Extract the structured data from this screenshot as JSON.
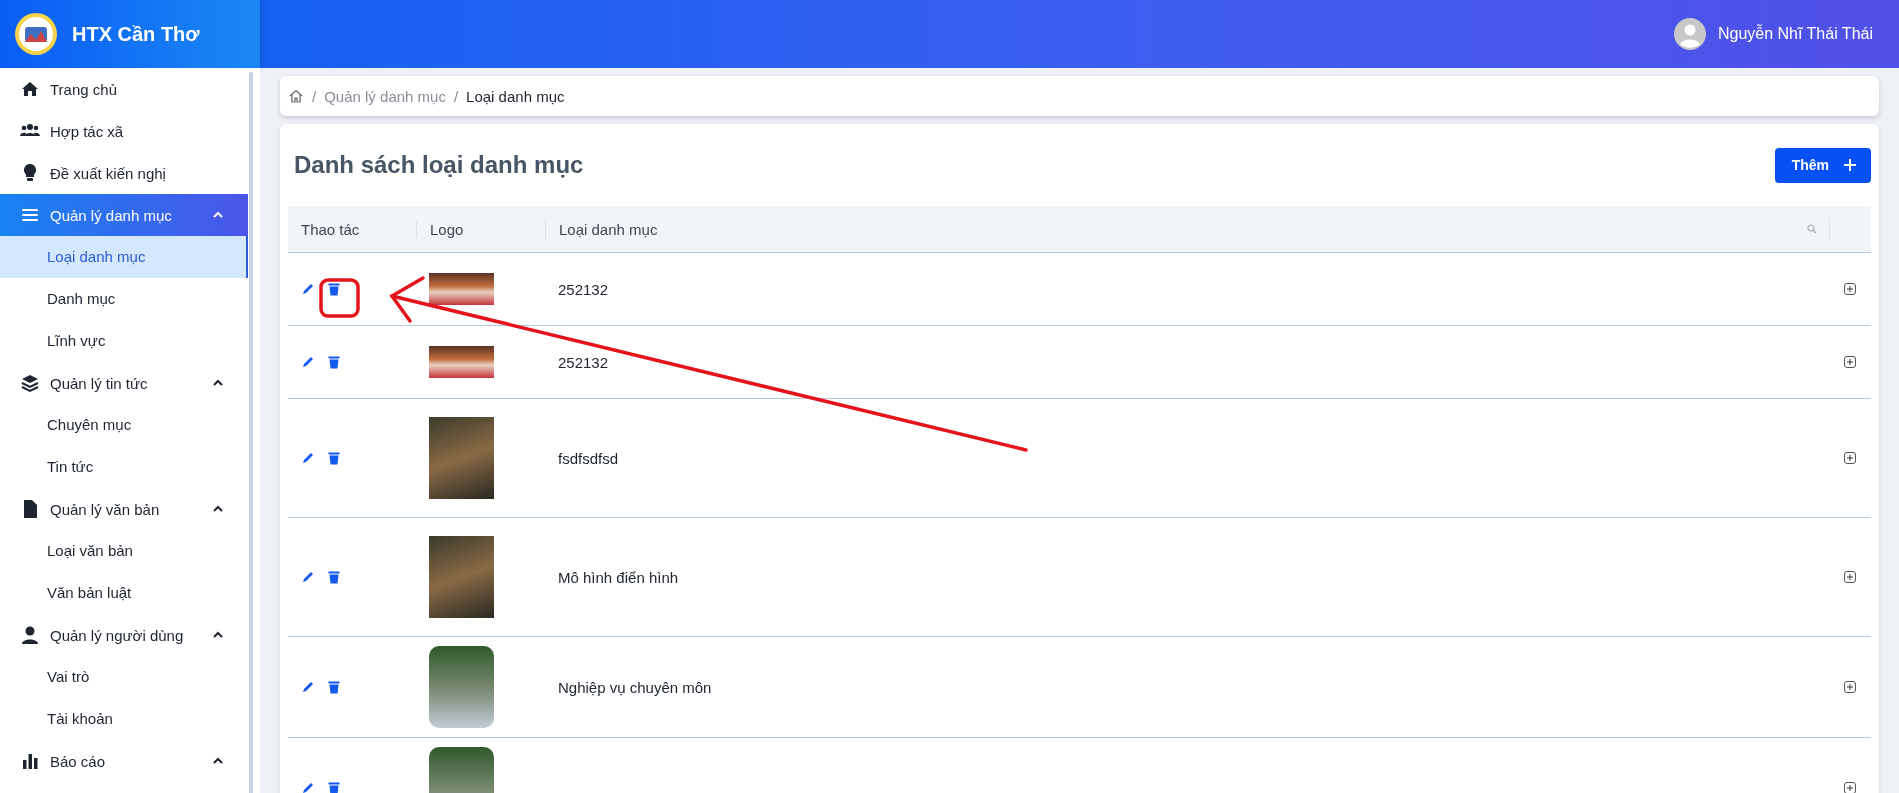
{
  "app": {
    "title": "HTX Cần Thơ"
  },
  "user": {
    "name": "Nguyễn Nhĩ Thái Thái"
  },
  "sidebar": {
    "items": [
      {
        "kind": "link",
        "label": "Trang chủ",
        "selected": false
      },
      {
        "kind": "link",
        "label": "Hợp tác xã",
        "selected": false
      },
      {
        "kind": "link",
        "label": "Đề xuất kiến nghị",
        "selected": false
      },
      {
        "kind": "group",
        "label": "Quản lý danh mục",
        "selected": true,
        "expanded": true,
        "children": [
          {
            "label": "Loại danh mục",
            "selected": true
          },
          {
            "label": "Danh mục",
            "selected": false
          },
          {
            "label": "Lĩnh vực",
            "selected": false
          }
        ]
      },
      {
        "kind": "group",
        "label": "Quản lý tin tức",
        "selected": false,
        "expanded": true,
        "children": [
          {
            "label": "Chuyên mục",
            "selected": false
          },
          {
            "label": "Tin tức",
            "selected": false
          }
        ]
      },
      {
        "kind": "group",
        "label": "Quản lý văn bản",
        "selected": false,
        "expanded": true,
        "children": [
          {
            "label": "Loại văn bản",
            "selected": false
          },
          {
            "label": "Văn bản luật",
            "selected": false
          }
        ]
      },
      {
        "kind": "group",
        "label": "Quản lý người dùng",
        "selected": false,
        "expanded": true,
        "children": [
          {
            "label": "Vai trò",
            "selected": false
          },
          {
            "label": "Tài khoản",
            "selected": false
          }
        ]
      },
      {
        "kind": "group",
        "label": "Báo cáo",
        "selected": false,
        "expanded": true
      }
    ]
  },
  "breadcrumb": {
    "separator": "/",
    "items": [
      "Quản lý danh mục",
      "Loại danh mục"
    ]
  },
  "page": {
    "title": "Danh sách loại danh mục",
    "add_button": "Thêm"
  },
  "table": {
    "columns": [
      "Thao tác",
      "Logo",
      "Loại danh mục"
    ],
    "rows": [
      {
        "logo": {
          "kind": "banner"
        },
        "name": "252132",
        "expanded": false
      },
      {
        "logo": {
          "kind": "banner"
        },
        "name": "252132",
        "expanded": false
      },
      {
        "logo": {
          "kind": "photo"
        },
        "name": "fsdfsdfsd",
        "expanded": false
      },
      {
        "logo": {
          "kind": "photo"
        },
        "name": "Mô hình điển hình",
        "expanded": false
      },
      {
        "logo": {
          "kind": "rounded"
        },
        "name": "Nghiệp vụ chuyên môn",
        "expanded": false
      },
      {
        "logo": {
          "kind": "rounded"
        },
        "expanded": false
      }
    ]
  },
  "annotations": [
    {
      "kind": "ring"
    },
    {
      "kind": "arrow"
    }
  ]
}
